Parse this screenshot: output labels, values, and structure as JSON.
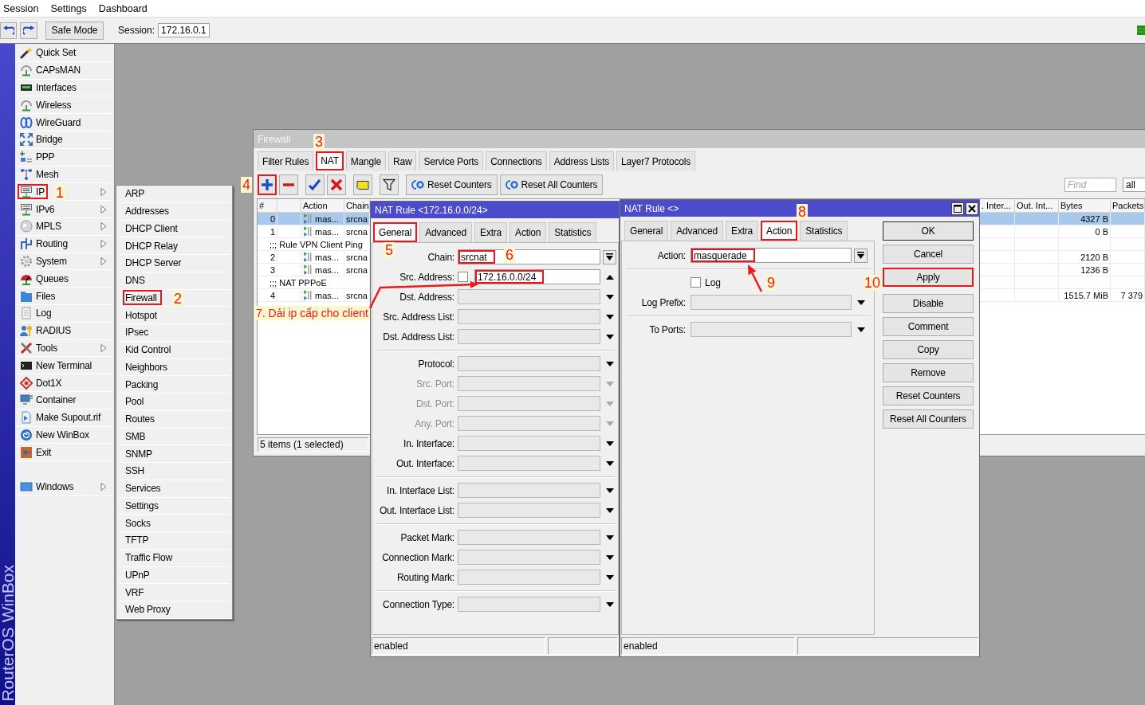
{
  "menu_bar": {
    "items": [
      "Session",
      "Settings",
      "Dashboard"
    ]
  },
  "toolbar": {
    "safe_mode": "Safe Mode",
    "session": {
      "label": "Session:",
      "value": "172.16.0.1"
    }
  },
  "side_banner": "RouterOS WinBox",
  "sidebar": {
    "groups": [
      {
        "items": [
          {
            "label": "Quick Set",
            "has_submenu": false,
            "highlighted": false
          },
          {
            "label": "CAPsMAN",
            "has_submenu": false,
            "highlighted": false
          },
          {
            "label": "Interfaces",
            "has_submenu": false,
            "highlighted": false
          },
          {
            "label": "Wireless",
            "has_submenu": false,
            "highlighted": false
          },
          {
            "label": "WireGuard",
            "has_submenu": false,
            "highlighted": false
          },
          {
            "label": "Bridge",
            "has_submenu": false,
            "highlighted": false
          },
          {
            "label": "PPP",
            "has_submenu": false,
            "highlighted": false
          },
          {
            "label": "Mesh",
            "has_submenu": false,
            "highlighted": false
          },
          {
            "label": "IP",
            "has_submenu": true,
            "highlighted": true
          },
          {
            "label": "IPv6",
            "has_submenu": true,
            "highlighted": false
          },
          {
            "label": "MPLS",
            "has_submenu": true,
            "highlighted": false
          },
          {
            "label": "Routing",
            "has_submenu": true,
            "highlighted": false
          },
          {
            "label": "System",
            "has_submenu": true,
            "highlighted": false
          },
          {
            "label": "Queues",
            "has_submenu": false,
            "highlighted": false
          },
          {
            "label": "Files",
            "has_submenu": false,
            "highlighted": false
          },
          {
            "label": "Log",
            "has_submenu": false,
            "highlighted": false
          },
          {
            "label": "RADIUS",
            "has_submenu": false,
            "highlighted": false
          },
          {
            "label": "Tools",
            "has_submenu": true,
            "highlighted": false
          },
          {
            "label": "New Terminal",
            "has_submenu": false,
            "highlighted": false
          },
          {
            "label": "Dot1X",
            "has_submenu": false,
            "highlighted": false
          },
          {
            "label": "Container",
            "has_submenu": false,
            "highlighted": false
          },
          {
            "label": "Make Supout.rif",
            "has_submenu": false,
            "highlighted": false
          },
          {
            "label": "New WinBox",
            "has_submenu": false,
            "highlighted": false
          },
          {
            "label": "Exit",
            "has_submenu": false,
            "highlighted": false
          }
        ]
      },
      {
        "items": [
          {
            "label": "Windows",
            "has_submenu": true,
            "highlighted": false
          }
        ]
      }
    ]
  },
  "submenu": {
    "items": [
      {
        "label": "ARP",
        "highlighted": false
      },
      {
        "label": "Addresses",
        "highlighted": false
      },
      {
        "label": "DHCP Client",
        "highlighted": false
      },
      {
        "label": "DHCP Relay",
        "highlighted": false
      },
      {
        "label": "DHCP Server",
        "highlighted": false
      },
      {
        "label": "DNS",
        "highlighted": false
      },
      {
        "label": "Firewall",
        "highlighted": true
      },
      {
        "label": "Hotspot",
        "highlighted": false
      },
      {
        "label": "IPsec",
        "highlighted": false
      },
      {
        "label": "Kid Control",
        "highlighted": false
      },
      {
        "label": "Neighbors",
        "highlighted": false
      },
      {
        "label": "Packing",
        "highlighted": false
      },
      {
        "label": "Pool",
        "highlighted": false
      },
      {
        "label": "Routes",
        "highlighted": false
      },
      {
        "label": "SMB",
        "highlighted": false
      },
      {
        "label": "SNMP",
        "highlighted": false
      },
      {
        "label": "SSH",
        "highlighted": false
      },
      {
        "label": "Services",
        "highlighted": false
      },
      {
        "label": "Settings",
        "highlighted": false
      },
      {
        "label": "Socks",
        "highlighted": false
      },
      {
        "label": "TFTP",
        "highlighted": false
      },
      {
        "label": "Traffic Flow",
        "highlighted": false
      },
      {
        "label": "UPnP",
        "highlighted": false
      },
      {
        "label": "VRF",
        "highlighted": false
      },
      {
        "label": "Web Proxy",
        "highlighted": false
      }
    ]
  },
  "firewall_window": {
    "title": "Firewall",
    "active": false,
    "tabs": [
      {
        "label": "Filter Rules",
        "selected": false,
        "highlighted": false
      },
      {
        "label": "NAT",
        "selected": true,
        "highlighted": true
      },
      {
        "label": "Mangle",
        "selected": false,
        "highlighted": false
      },
      {
        "label": "Raw",
        "selected": false,
        "highlighted": false
      },
      {
        "label": "Service Ports",
        "selected": false,
        "highlighted": false
      },
      {
        "label": "Connections",
        "selected": false,
        "highlighted": false
      },
      {
        "label": "Address Lists",
        "selected": false,
        "highlighted": false
      },
      {
        "label": "Layer7 Protocols",
        "selected": false,
        "highlighted": false
      }
    ],
    "button_groups": [
      {
        "buttons": [
          {
            "kind": "add",
            "highlighted": true
          },
          {
            "kind": "remove",
            "highlighted": false
          }
        ]
      },
      {
        "buttons": [
          {
            "kind": "enable",
            "highlighted": false
          },
          {
            "kind": "disable",
            "highlighted": false
          }
        ]
      },
      {
        "buttons": [
          {
            "kind": "comment",
            "highlighted": false
          }
        ]
      },
      {
        "buttons": [
          {
            "kind": "filter",
            "highlighted": false
          }
        ]
      },
      {
        "buttons": [
          {
            "kind": "reset",
            "label": "Reset Counters",
            "highlighted": false
          },
          {
            "kind": "reset",
            "label": "Reset All Counters",
            "highlighted": false
          }
        ]
      }
    ],
    "find": {
      "placeholder": "Find"
    },
    "scope": "all",
    "table": {
      "columns": {
        "number": "#",
        "action": "Action",
        "chain": "Chain",
        "column_5": ". Inter...",
        "column_6": "Out. Int...",
        "bytes": "Bytes",
        "packets": "Packets"
      },
      "rows": [
        {
          "kind": "rule",
          "selected": true,
          "number": "0",
          "action": "mas...",
          "chain": "srcna",
          "bytes": "4327 B"
        },
        {
          "kind": "rule",
          "selected": false,
          "number": "1",
          "action": "mas...",
          "chain": "srcna",
          "bytes": "0 B"
        },
        {
          "kind": "comment",
          "selected": false,
          "text": ";;; Rule VPN Client Ping"
        },
        {
          "kind": "rule",
          "selected": false,
          "number": "2",
          "action": "mas...",
          "chain": "srcna",
          "bytes": "2120 B"
        },
        {
          "kind": "rule",
          "selected": false,
          "number": "3",
          "action": "mas...",
          "chain": "srcna",
          "bytes": "1236 B"
        },
        {
          "kind": "comment",
          "selected": false,
          "text": ";;; NAT PPPoE"
        },
        {
          "kind": "rule",
          "selected": false,
          "number": "4",
          "action": "mas...",
          "chain": "srcna",
          "bytes": "1515.7 MiB",
          "packets": "7 379"
        }
      ]
    },
    "status": "5 items (1 selected)"
  },
  "dialogs": [
    {
      "title": "NAT Rule <172.16.0.0/24>",
      "active": true,
      "tabs": [
        {
          "label": "General",
          "selected": true,
          "highlighted": true
        },
        {
          "label": "Advanced",
          "selected": false,
          "highlighted": false
        },
        {
          "label": "Extra",
          "selected": false,
          "highlighted": false
        },
        {
          "label": "Action",
          "selected": false,
          "highlighted": false
        },
        {
          "label": "Statistics",
          "selected": false,
          "highlighted": false
        }
      ],
      "groups": [
        {
          "fields": [
            {
              "kind": "combo",
              "label": "Chain:",
              "value": "srcnat",
              "highlighted": true,
              "disabled": false
            },
            {
              "kind": "negatable",
              "label": "Src. Address:",
              "value": "172.16.0.0/24",
              "negated": false,
              "expanded": true,
              "highlighted": true,
              "disabled": false
            },
            {
              "kind": "plain",
              "label": "Dst. Address:",
              "expanded": false,
              "highlighted": false,
              "disabled": false
            },
            {
              "kind": "plain",
              "label": "Src. Address List:",
              "expanded": false,
              "highlighted": false,
              "disabled": false
            },
            {
              "kind": "plain",
              "label": "Dst. Address List:",
              "expanded": false,
              "highlighted": false,
              "disabled": false
            }
          ]
        },
        {
          "fields": [
            {
              "kind": "plain",
              "label": "Protocol:",
              "expanded": false,
              "highlighted": false,
              "disabled": false
            },
            {
              "kind": "plain",
              "label": "Src. Port:",
              "expanded": false,
              "highlighted": false,
              "disabled": true
            },
            {
              "kind": "plain",
              "label": "Dst. Port:",
              "expanded": false,
              "highlighted": false,
              "disabled": true
            },
            {
              "kind": "plain",
              "label": "Any. Port:",
              "expanded": false,
              "highlighted": false,
              "disabled": true
            },
            {
              "kind": "plain",
              "label": "In. Interface:",
              "expanded": false,
              "highlighted": false,
              "disabled": false
            },
            {
              "kind": "plain",
              "label": "Out. Interface:",
              "expanded": false,
              "highlighted": false,
              "disabled": false
            }
          ]
        },
        {
          "fields": [
            {
              "kind": "plain",
              "label": "In. Interface List:",
              "expanded": false,
              "highlighted": false,
              "disabled": false
            },
            {
              "kind": "plain",
              "label": "Out. Interface List:",
              "expanded": false,
              "highlighted": false,
              "disabled": false
            }
          ]
        },
        {
          "fields": [
            {
              "kind": "plain",
              "label": "Packet Mark:",
              "expanded": false,
              "highlighted": false,
              "disabled": false
            },
            {
              "kind": "plain",
              "label": "Connection Mark:",
              "expanded": false,
              "highlighted": false,
              "disabled": false
            },
            {
              "kind": "plain",
              "label": "Routing Mark:",
              "expanded": false,
              "highlighted": false,
              "disabled": false
            }
          ]
        },
        {
          "fields": [
            {
              "kind": "plain",
              "label": "Connection Type:",
              "expanded": false,
              "highlighted": false,
              "disabled": false
            }
          ]
        }
      ],
      "status": "enabled"
    },
    {
      "title": "NAT Rule <>",
      "active": true,
      "window_buttons": true,
      "tabs": [
        {
          "label": "General",
          "selected": false,
          "highlighted": false
        },
        {
          "label": "Advanced",
          "selected": false,
          "highlighted": false
        },
        {
          "label": "Extra",
          "selected": false,
          "highlighted": false
        },
        {
          "label": "Action",
          "selected": true,
          "highlighted": true
        },
        {
          "label": "Statistics",
          "selected": false,
          "highlighted": false
        }
      ],
      "groups": [
        {
          "fields": [
            {
              "kind": "combo",
              "label": "Action:",
              "value": "masquerade",
              "highlighted": true,
              "disabled": false
            }
          ]
        },
        {
          "fields": [
            {
              "kind": "checkbox",
              "label": "Log",
              "checked": false,
              "highlighted": false,
              "disabled": false
            },
            {
              "kind": "plain",
              "label": "Log Prefix:",
              "expanded": false,
              "highlighted": false,
              "disabled": false
            }
          ]
        },
        {
          "fields": [
            {
              "kind": "plain",
              "label": "To Ports:",
              "expanded": false,
              "highlighted": false,
              "disabled": false
            }
          ]
        }
      ],
      "button_groups": [
        {
          "buttons": [
            {
              "label": "OK",
              "default": true,
              "highlighted": false
            },
            {
              "label": "Cancel",
              "default": false,
              "highlighted": false
            },
            {
              "label": "Apply",
              "default": false,
              "highlighted": true
            }
          ]
        },
        {
          "buttons": [
            {
              "label": "Disable",
              "default": false,
              "highlighted": false
            },
            {
              "label": "Comment",
              "default": false,
              "highlighted": false
            },
            {
              "label": "Copy",
              "default": false,
              "highlighted": false
            },
            {
              "label": "Remove",
              "default": false,
              "highlighted": false
            },
            {
              "label": "Reset Counters",
              "default": false,
              "highlighted": false
            },
            {
              "label": "Reset All Counters",
              "default": false,
              "highlighted": false
            }
          ]
        }
      ],
      "status": "enabled"
    }
  ],
  "annotations": [
    {
      "label": "1"
    },
    {
      "label": "2"
    },
    {
      "label": "3"
    },
    {
      "label": "4"
    },
    {
      "label": "5"
    },
    {
      "label": "6"
    },
    {
      "label": "7. Dải ip cấp cho client",
      "arrow": true
    },
    {
      "label": "8"
    },
    {
      "label": "9",
      "arrow": true
    },
    {
      "label": "10"
    }
  ]
}
